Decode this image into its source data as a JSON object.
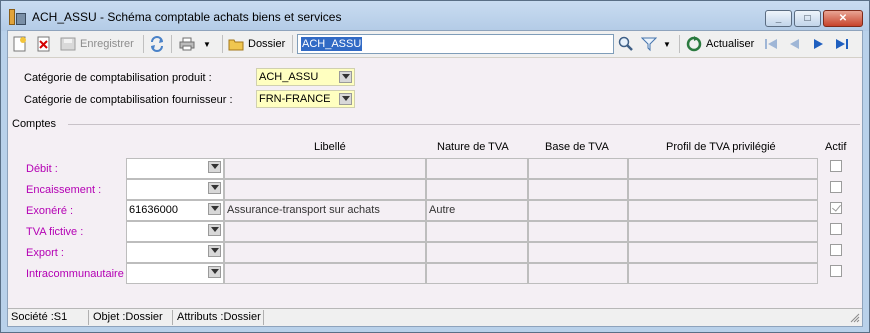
{
  "window": {
    "title": "ACH_ASSU -  Schéma comptable achats biens et services",
    "buttons": {
      "minimize": "_",
      "maximize": "□",
      "close": "✕"
    }
  },
  "toolbar": {
    "save_label": "Enregistrer",
    "folder_label": "Dossier",
    "search_value": "ACH_ASSU",
    "refresh_label": "Actualiser"
  },
  "form": {
    "product_category": {
      "label": "Catégorie de comptabilisation produit :",
      "value": "ACH_ASSU"
    },
    "supplier_category": {
      "label": "Catégorie de comptabilisation fournisseur :",
      "value": "FRN-FRANCE"
    },
    "section_label": "Comptes",
    "columns": {
      "libelle": "Libellé",
      "nature": "Nature de TVA",
      "base": "Base de TVA",
      "profil": "Profil de TVA privilégié",
      "actif": "Actif"
    },
    "rows": [
      {
        "label": "Débit :",
        "account": "",
        "libelle": "",
        "nature": "",
        "active": false
      },
      {
        "label": "Encaissement :",
        "account": "",
        "libelle": "",
        "nature": "",
        "active": false
      },
      {
        "label": "Exonéré :",
        "account": "61636000",
        "libelle": "Assurance-transport sur achats",
        "nature": "Autre",
        "active": true
      },
      {
        "label": "TVA fictive :",
        "account": "",
        "libelle": "",
        "nature": "",
        "active": false
      },
      {
        "label": "Export :",
        "account": "",
        "libelle": "",
        "nature": "",
        "active": false
      },
      {
        "label": "Intracommunautaire :",
        "account": "",
        "libelle": "",
        "nature": "",
        "active": false
      }
    ]
  },
  "status": {
    "societe": "Société :S1",
    "objet": "Objet :Dossier",
    "attributs": "Attributs :Dossier"
  },
  "colors": {
    "accent": "#316ac5",
    "row_label": "#b400b4",
    "field_yellow": "#ffffc0"
  }
}
